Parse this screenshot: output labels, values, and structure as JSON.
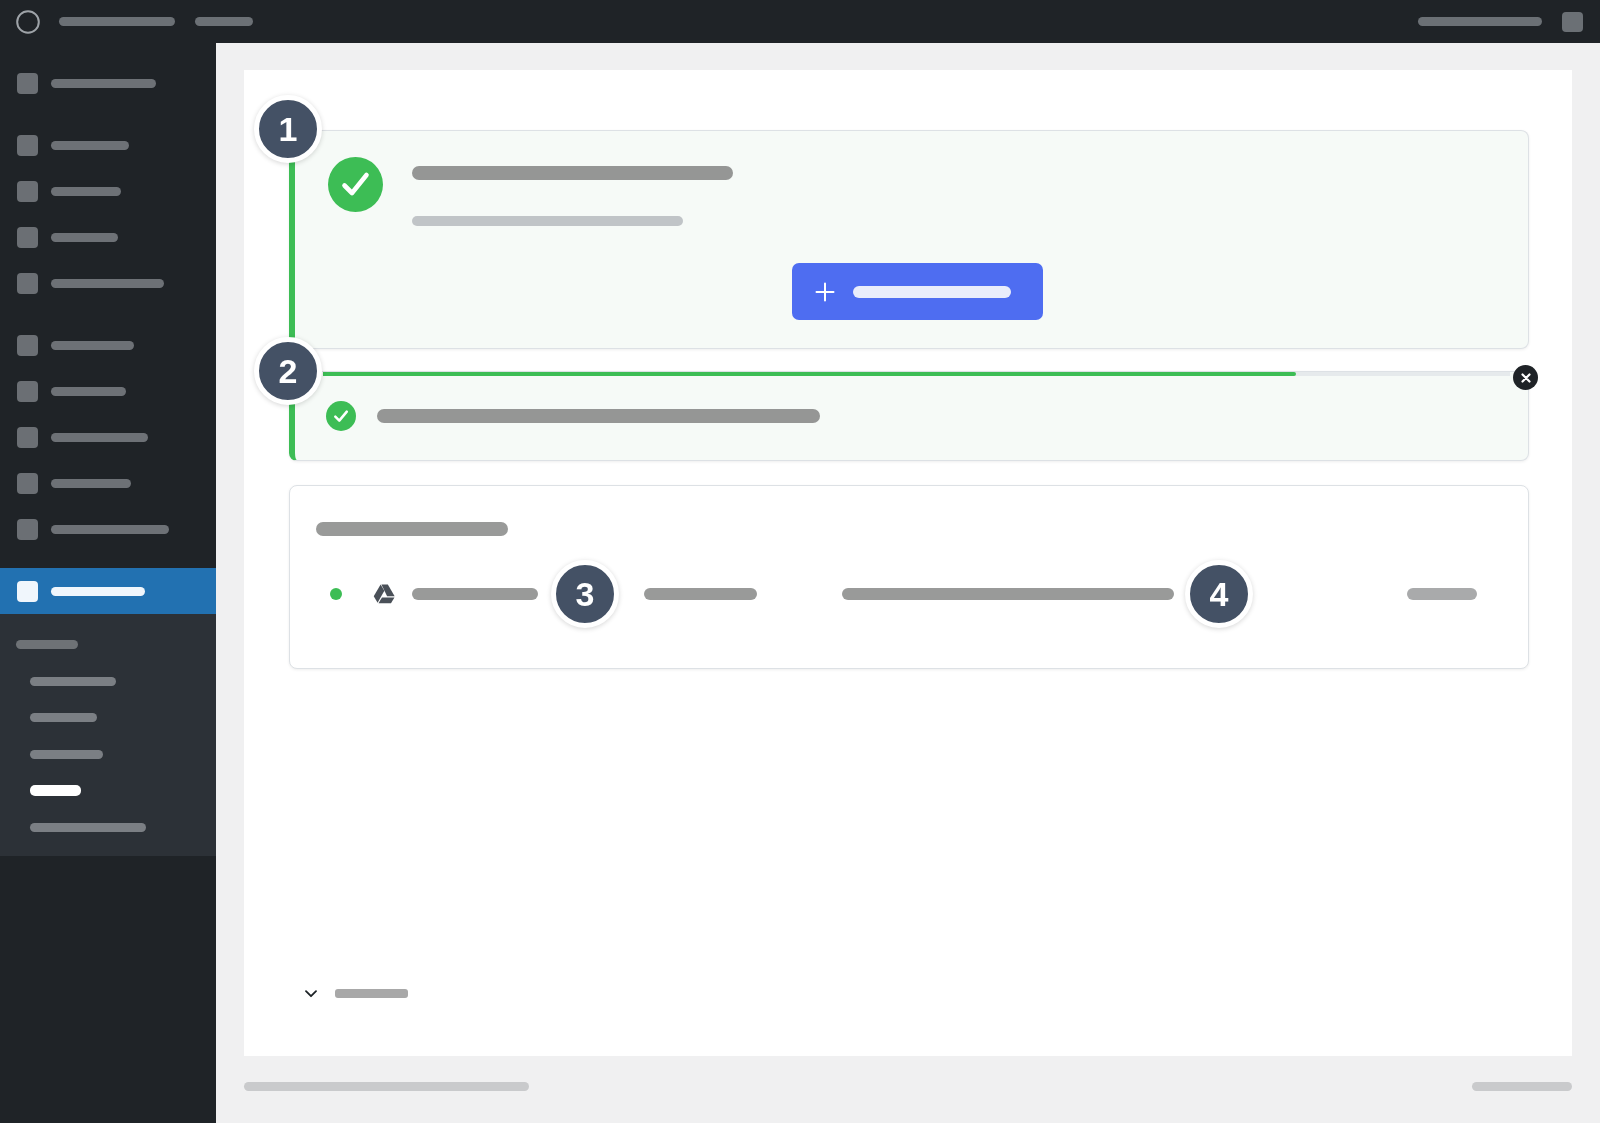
{
  "sidebar": {
    "groups": [
      {
        "items": [
          {
            "selected": false
          }
        ]
      },
      {
        "items": [
          {
            "selected": false
          },
          {
            "selected": false
          },
          {
            "selected": false
          },
          {
            "selected": false
          }
        ]
      },
      {
        "items": [
          {
            "selected": false
          },
          {
            "selected": false
          },
          {
            "selected": false
          },
          {
            "selected": false
          },
          {
            "selected": false
          }
        ]
      },
      {
        "items": [
          {
            "selected": true
          }
        ]
      }
    ],
    "submenu": {
      "items": [
        {
          "selected": false
        },
        {
          "selected": false
        },
        {
          "selected": false
        },
        {
          "selected": true
        },
        {
          "selected": false
        }
      ]
    }
  },
  "success_card": {
    "marker": "1"
  },
  "notice": {
    "marker": "2",
    "progress": {
      "level": 0.82
    }
  },
  "connections_card": {
    "rows": [
      {
        "color": "#3dbd55",
        "callouts": [
          "3",
          "4"
        ]
      }
    ]
  }
}
